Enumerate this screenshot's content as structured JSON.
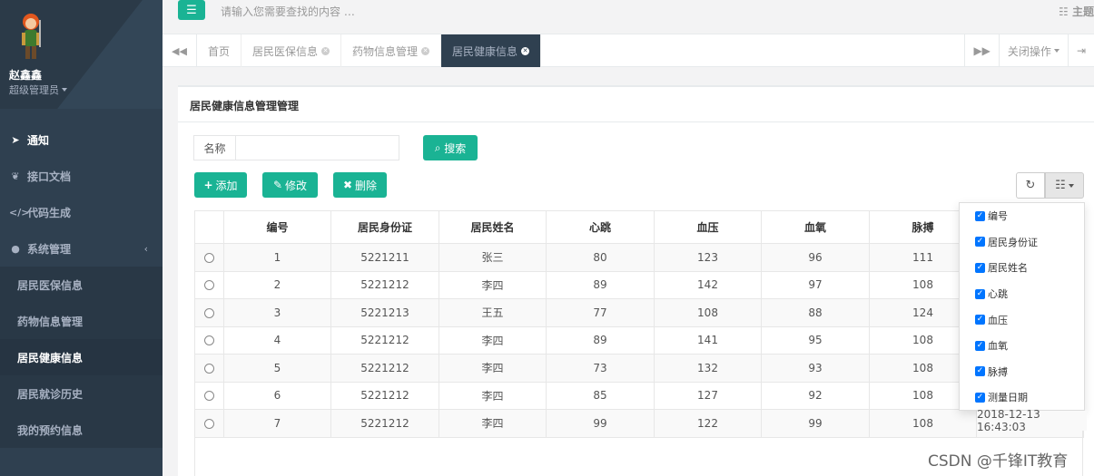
{
  "user": {
    "name": "赵鑫鑫",
    "role": "超级管理员"
  },
  "search": {
    "placeholder": "请输入您需要查找的内容 …"
  },
  "theme_label": "主题",
  "sidebar": {
    "items": [
      {
        "label": "通知",
        "icon": "paper-plane-icon"
      },
      {
        "label": "接口文档",
        "icon": "leaf-icon"
      },
      {
        "label": "代码生成",
        "icon": "code-icon"
      },
      {
        "label": "系统管理",
        "icon": "user-icon"
      },
      {
        "label": "居民医保信息"
      },
      {
        "label": "药物信息管理"
      },
      {
        "label": "居民健康信息"
      },
      {
        "label": "居民就诊历史"
      },
      {
        "label": "我的预约信息"
      }
    ]
  },
  "tabs": [
    {
      "label": "首页"
    },
    {
      "label": "居民医保信息"
    },
    {
      "label": "药物信息管理"
    },
    {
      "label": "居民健康信息"
    }
  ],
  "tab_actions": {
    "close_ops": "关闭操作"
  },
  "panel": {
    "title": "居民健康信息管理管理",
    "filter_label": "名称",
    "search_btn": "搜索",
    "add_btn": "添加",
    "edit_btn": "修改",
    "delete_btn": "删除"
  },
  "table": {
    "headers": [
      "编号",
      "居民身份证",
      "居民姓名",
      "心跳",
      "血压",
      "血氧",
      "脉搏"
    ],
    "rows": [
      [
        "1",
        "5221211",
        "张三",
        "80",
        "123",
        "96",
        "111"
      ],
      [
        "2",
        "5221212",
        "李四",
        "89",
        "142",
        "97",
        "108"
      ],
      [
        "3",
        "5221213",
        "王五",
        "77",
        "108",
        "88",
        "124"
      ],
      [
        "4",
        "5221212",
        "李四",
        "89",
        "141",
        "95",
        "108"
      ],
      [
        "5",
        "5221212",
        "李四",
        "73",
        "132",
        "93",
        "108"
      ],
      [
        "6",
        "5221212",
        "李四",
        "85",
        "127",
        "92",
        "108"
      ],
      [
        "7",
        "5221212",
        "李四",
        "99",
        "122",
        "99",
        "108"
      ]
    ],
    "last_row_date": "2018-12-13 16:43:03"
  },
  "columns_menu": [
    "编号",
    "居民身份证",
    "居民姓名",
    "心跳",
    "血压",
    "血氧",
    "脉搏",
    "测量日期"
  ],
  "watermark": "CSDN @千锋IT教育",
  "colors": {
    "accent": "#1ab394",
    "sidebar": "#2f4050"
  }
}
